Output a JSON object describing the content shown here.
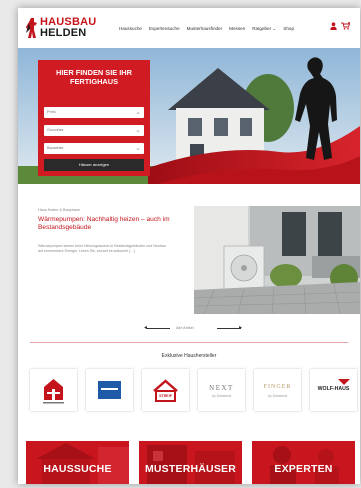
{
  "brand": {
    "line1": "HAUSBAU",
    "line2": "HELDEN",
    "accent": "#c3141c"
  },
  "nav": {
    "items": [
      "Haussuche",
      "Expertensuche",
      "Musterhausfinder",
      "Messen",
      "Ratgeber ⌄",
      "Shop"
    ],
    "icons": [
      "user-icon",
      "cart-icon"
    ]
  },
  "hero": {
    "title": "HIER FINDEN SIE IHR FERTIGHAUS",
    "selects": [
      "Preis",
      "Grundriss",
      "Bauweise"
    ],
    "button": "Häuser anzeigen"
  },
  "article": {
    "category": "Haus finden & Bauphase",
    "title": "Wärmepumpen: Nachhaltig heizen – auch im Bestandsgebäude",
    "excerpt": "Wärmepumpen setzen beim Heizungstausch in Bestandsgebäuden und Neubau auf erneuerbare Energie. Lesen Sie, worauf es ankommt […]"
  },
  "pager": {
    "label": "Alle Artikel"
  },
  "manufacturers": {
    "title": "Exklusive Haushersteller",
    "items": [
      {
        "name": "schwabenhaus",
        "text": ""
      },
      {
        "name": "okal",
        "text": ""
      },
      {
        "name": "streif",
        "text": "STREIF"
      },
      {
        "name": "next",
        "text": "NEXT",
        "sub": "by Danwood"
      },
      {
        "name": "fingerhaus",
        "text": "FINGER",
        "sub": "by Danwood"
      },
      {
        "name": "wolf-haus",
        "text": "WOLF-HAUS"
      }
    ]
  },
  "categories": [
    {
      "label": "HAUSSUCHE"
    },
    {
      "label": "MUSTERHÄUSER"
    },
    {
      "label": "EXPERTEN"
    }
  ]
}
